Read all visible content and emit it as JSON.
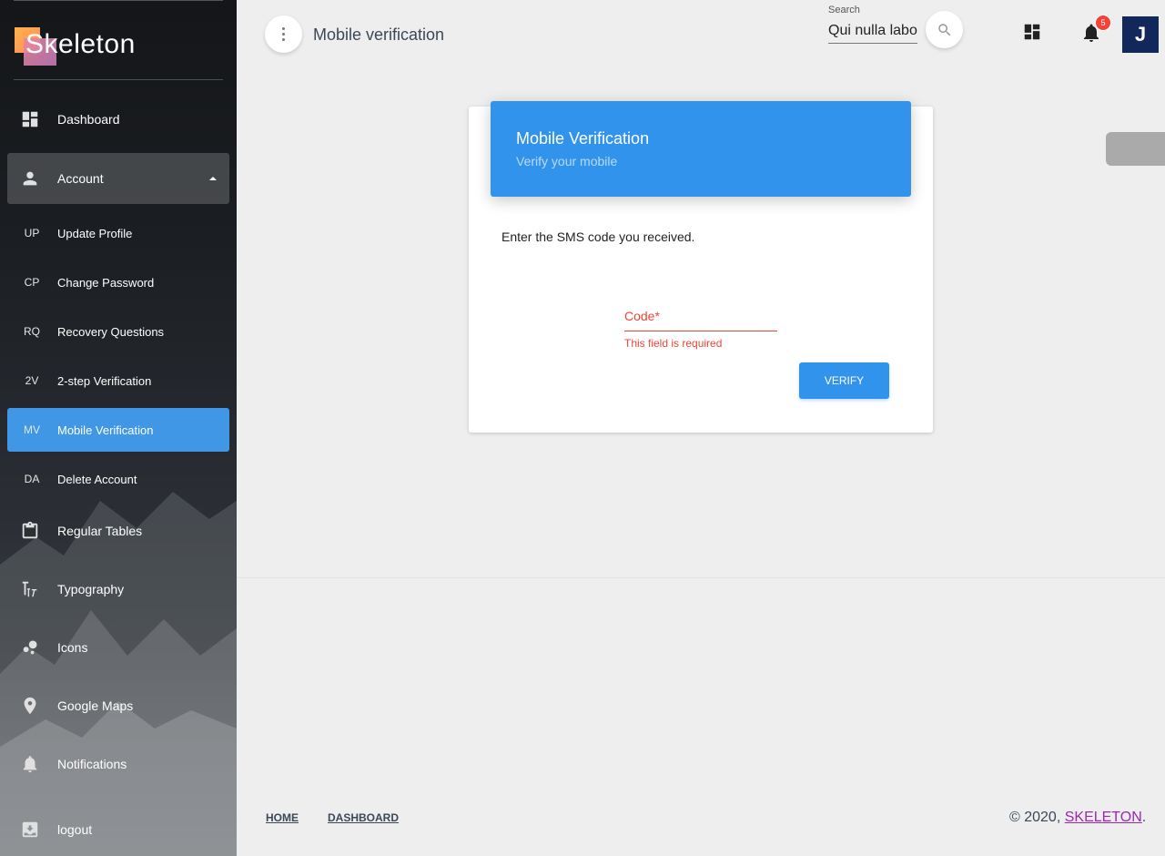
{
  "brand": {
    "name": "Skeleton"
  },
  "header": {
    "page_title": "Mobile verification",
    "search": {
      "label": "Search",
      "value": "Qui nulla labor"
    },
    "notifications_count": "5",
    "avatar_initial": "J"
  },
  "sidebar": {
    "items": [
      {
        "label": "Dashboard",
        "icon": "dashboard-icon"
      },
      {
        "label": "Account",
        "icon": "person-icon",
        "expanded": true
      },
      {
        "abbr": "UP",
        "label": "Update Profile"
      },
      {
        "abbr": "CP",
        "label": "Change Password"
      },
      {
        "abbr": "RQ",
        "label": "Recovery Questions"
      },
      {
        "abbr": "2V",
        "label": "2-step Verification"
      },
      {
        "abbr": "MV",
        "label": "Mobile Verification",
        "active": true
      },
      {
        "abbr": "DA",
        "label": "Delete Account"
      },
      {
        "label": "Regular Tables",
        "icon": "clipboard-icon"
      },
      {
        "label": "Typography",
        "icon": "typography-icon"
      },
      {
        "label": "Icons",
        "icon": "bubble-chart-icon"
      },
      {
        "label": "Google Maps",
        "icon": "location-pin-icon"
      },
      {
        "label": "Notifications",
        "icon": "bell-icon"
      },
      {
        "label": "logout",
        "icon": "logout-icon"
      }
    ]
  },
  "card": {
    "title": "Mobile Verification",
    "subtitle": "Verify your mobile",
    "instruction": "Enter the SMS code you received.",
    "code_label": "Code*",
    "code_error": "This field is required",
    "verify_label": "VERIFY"
  },
  "footer": {
    "links": [
      "HOME",
      "DASHBOARD"
    ],
    "copyright_prefix": "© 2020, ",
    "copyright_brand": "SKELETON",
    "copyright_suffix": "."
  },
  "colors": {
    "primary": "#3293ec",
    "active_nav": "#3f97e6",
    "error": "#f44336",
    "link": "#9c27b0",
    "avatar_bg": "#12275a"
  }
}
